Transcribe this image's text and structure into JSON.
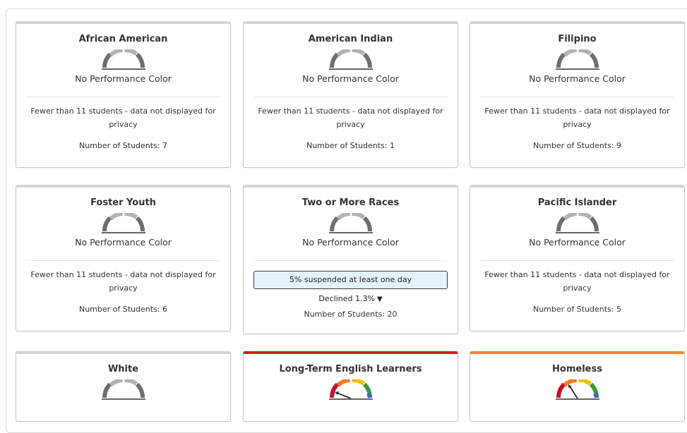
{
  "colors": {
    "gauge_gray_dark": "#6e6e6e",
    "gauge_gray_light": "#b3b3b3",
    "gauge_red": "#c8102e",
    "gauge_orange": "#ef7d22",
    "gauge_yellow": "#f2c200",
    "gauge_green": "#3a9a3a",
    "gauge_blue": "#3b67c0",
    "card_top_red": "#d7191c",
    "card_top_orange": "#f0843a",
    "stat_box_bg": "#e6f3fc"
  },
  "cards": [
    {
      "title": "African American",
      "performance": "No Performance Color",
      "note": "Fewer than 11 students - data not displayed for privacy",
      "count": "Number of Students: 7"
    },
    {
      "title": "American Indian",
      "performance": "No Performance Color",
      "note": "Fewer than 11 students - data not displayed for privacy",
      "count": "Number of Students: 1"
    },
    {
      "title": "Filipino",
      "performance": "No Performance Color",
      "note": "Fewer than 11 students - data not displayed for privacy",
      "count": "Number of Students: 9"
    },
    {
      "title": "Foster Youth",
      "performance": "No Performance Color",
      "note": "Fewer than 11 students - data not displayed for privacy",
      "count": "Number of Students: 6"
    },
    {
      "title": "Two or More Races",
      "performance": "No Performance Color",
      "stat": "5% suspended at least one day",
      "change": "Declined 1.3%",
      "change_icon": "down-triangle-icon",
      "count": "Number of Students: 20"
    },
    {
      "title": "Pacific Islander",
      "performance": "No Performance Color",
      "note": "Fewer than 11 students - data not displayed for privacy",
      "count": "Number of Students: 5"
    },
    {
      "title": "White"
    },
    {
      "title": "Long-Term English Learners",
      "top_color": "red"
    },
    {
      "title": "Homeless",
      "top_color": "orange"
    }
  ]
}
